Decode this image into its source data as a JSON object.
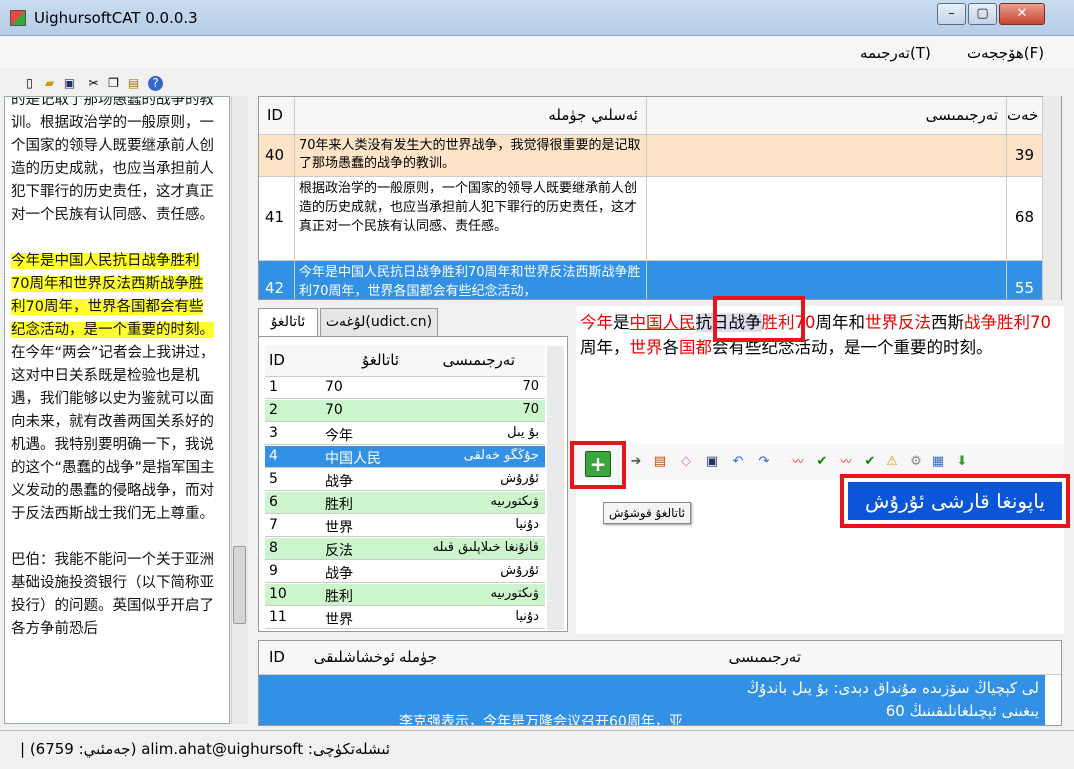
{
  "window": {
    "title": "UighursoftCAT 0.0.0.3",
    "min": "–",
    "max": "▢",
    "close": "✕"
  },
  "menu": {
    "file": "هۆججەت(F)",
    "translation": "تەرجىمە(T)"
  },
  "source": {
    "paragraphs": [
      {
        "pre": "的是记取了那场愚蠢的战争的教训。根据政治学的一般原则，一个国家的领导人既要继承前人创造的历史成就，也应当承担前人犯下罪行的历史责任，这才真正对一个民族有认同感、责任感。",
        "hl": "",
        "post": ""
      },
      {
        "pre": "",
        "hl": "今年是中国人民抗日战争胜利70周年和世界反法西斯战争胜利70周年，世界各国都会有些纪念活动，是一个重要的时刻。",
        "post": "在今年“两会”记者会上我讲过，这对中日关系既是检验也是机遇，我们能够以史为鉴就可以面向未来，就有改善两国关系好的机遇。我特别要明确一下，我说的这个“愚蠢的战争”是指军国主义发动的愚蠢的侵略战争，而对于反法西斯战士我们无上尊重。"
      },
      {
        "pre": "巴伯：我能不能问一个关于亚洲基础设施投资银行（以下简称亚投行）的问题。英国似乎开启了各方争前恐后",
        "hl": "",
        "post": ""
      }
    ]
  },
  "grid": {
    "headers": {
      "id": "ID",
      "source": "ئەسلىي جۈملە",
      "target": "تەرجىمىسى",
      "chars": "خەت"
    },
    "rows": [
      {
        "id": "40",
        "source": "70年来人类没有发生大的世界战争，我觉得很重要的是记取了那场愚蠢的战争的教训。",
        "target": "",
        "chars": "39"
      },
      {
        "id": "41",
        "source": "根据政治学的一般原则，一个国家的领导人既要继承前人创造的历史成就，也应当承担前人犯下罪行的历史责任，这才真正对一个民族有认同感、责任感。",
        "target": "",
        "chars": "68"
      },
      {
        "id": "42",
        "source": "今年是中国人民抗日战争胜利70周年和世界反法西斯战争胜利70周年，世界各国都会有些纪念活动，",
        "target": "",
        "chars": "55"
      }
    ]
  },
  "tabs": {
    "glossary": "ئاتالغۇ",
    "udict": "لۇغەت(udict.cn)"
  },
  "glossary": {
    "headers": {
      "id": "ID",
      "term": "ئاتالغۇ",
      "trans": "تەرجىمىسى"
    },
    "rows": [
      {
        "id": "1",
        "term": "70",
        "trans": "70"
      },
      {
        "id": "2",
        "term": "70",
        "trans": "70"
      },
      {
        "id": "3",
        "term": "今年",
        "trans": "بۇ يىل"
      },
      {
        "id": "4",
        "term": "中国人民",
        "trans": "جۇڭگو خەلقى"
      },
      {
        "id": "5",
        "term": "战争",
        "trans": "ئۇرۇش"
      },
      {
        "id": "6",
        "term": "胜利",
        "trans": "ۋىكتورىيە"
      },
      {
        "id": "7",
        "term": "世界",
        "trans": "دۇنيا"
      },
      {
        "id": "8",
        "term": "反法",
        "trans": "قانۇنغا خىلاپلىق قىلە"
      },
      {
        "id": "9",
        "term": "战争",
        "trans": "ئۇرۇش"
      },
      {
        "id": "10",
        "term": "胜利",
        "trans": "ۋىكتورىيە"
      },
      {
        "id": "11",
        "term": "世界",
        "trans": "دۇنيا"
      }
    ]
  },
  "editor": {
    "segments": [
      [
        "red",
        "今年"
      ],
      [
        "n",
        "是"
      ],
      [
        "ul",
        "中国人民"
      ],
      [
        "sel",
        "抗日战争"
      ],
      [
        "red",
        "胜利70"
      ],
      [
        "n",
        "周年和"
      ],
      [
        "red",
        "世界反法"
      ],
      [
        "n",
        "西斯"
      ],
      [
        "red",
        "战争胜利70"
      ],
      [
        "n",
        "周年，"
      ],
      [
        "red",
        "世界"
      ],
      [
        "n",
        "各"
      ],
      [
        "red",
        "国都"
      ],
      [
        "n",
        "会有些纪念活动，是一个重要的时刻。"
      ]
    ]
  },
  "tooltip": "ئاتالغۇ قوشۇش",
  "callout": "ياپونغا قارشى ئۇرۇش",
  "tm": {
    "headers": {
      "id": "ID",
      "sim": "ئوخشاشلىقى",
      "sentence": "جۈملە",
      "trans": "تەرجىمىسى"
    },
    "row": {
      "sentence": "李克强表示，今年是万隆会议召开60周年，亚",
      "trans": "لى كېچياڭ سۆزىدە مۇنداق دېدى: بۇ يىل باندۇڭ يىغىنى ئېچىلغانلىقىنىڭ 60"
    }
  },
  "status": "| (6759 :جەمئىي) alim.ahat@uighursoft :ئىشلەتكۈچى"
}
